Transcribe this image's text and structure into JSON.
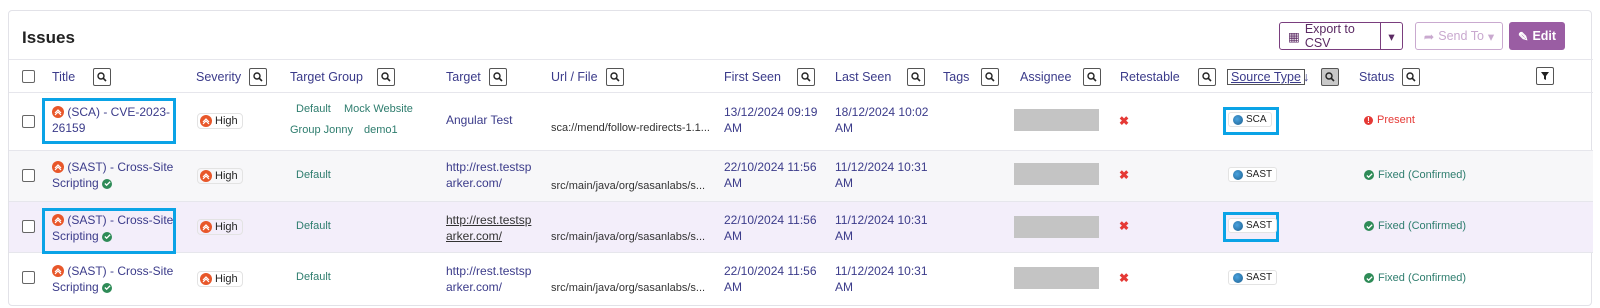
{
  "header": {
    "title": "Issues",
    "export_label": "Export to CSV",
    "send_label": "Send To",
    "edit_label": "Edit"
  },
  "columns": [
    "Title",
    "Severity",
    "Target Group",
    "Target",
    "Url / File",
    "First Seen",
    "Last Seen",
    "Tags",
    "Assignee",
    "Retestable",
    "Source Type",
    "Status"
  ],
  "rows": [
    {
      "title_line1": "(SCA) - CVE-2023-",
      "title_line2": "26159",
      "severity": "High",
      "groups": [
        "Default",
        "Mock Website",
        "Group Jonny",
        "demo1"
      ],
      "target_line1": "Angular Test",
      "target_line2": "",
      "url": "sca://mend/follow-redirects-1.1...",
      "first_seen_1": "13/12/2024 09:19",
      "first_seen_2": "AM",
      "last_seen_1": "18/12/2024 10:02",
      "last_seen_2": "AM",
      "retestable": "✖",
      "source": "SCA",
      "status": "Present"
    },
    {
      "title_line1": "(SAST) - Cross-Site",
      "title_line2": "Scripting",
      "severity": "High",
      "groups": [
        "Default"
      ],
      "target_line1": "http://rest.testsp",
      "target_line2": "arker.com/",
      "url": "src/main/java/org/sasanlabs/s...",
      "first_seen_1": "22/10/2024 11:56",
      "first_seen_2": "AM",
      "last_seen_1": "11/12/2024 10:31",
      "last_seen_2": "AM",
      "retestable": "✖",
      "source": "SAST",
      "status": "Fixed (Confirmed)"
    },
    {
      "title_line1": "(SAST) - Cross-Site",
      "title_line2": "Scripting",
      "severity": "High",
      "groups": [
        "Default"
      ],
      "target_line1": "http://rest.testsp",
      "target_line2": "arker.com/",
      "url": "src/main/java/org/sasanlabs/s...",
      "first_seen_1": "22/10/2024 11:56",
      "first_seen_2": "AM",
      "last_seen_1": "11/12/2024 10:31",
      "last_seen_2": "AM",
      "retestable": "✖",
      "source": "SAST",
      "status": "Fixed (Confirmed)"
    },
    {
      "title_line1": "(SAST) - Cross-Site",
      "title_line2": "Scripting",
      "severity": "High",
      "groups": [
        "Default"
      ],
      "target_line1": "http://rest.testsp",
      "target_line2": "arker.com/",
      "url": "src/main/java/org/sasanlabs/s...",
      "first_seen_1": "22/10/2024 11:56",
      "first_seen_2": "AM",
      "last_seen_1": "11/12/2024 10:31",
      "last_seen_2": "AM",
      "retestable": "✖",
      "source": "SAST",
      "status": "Fixed (Confirmed)"
    }
  ],
  "colors": {
    "accent": "#9a5da3",
    "link": "#3b3b8a",
    "highlight": "#0aa3e6",
    "present": "#e53935",
    "fixed": "#2e8b57"
  }
}
